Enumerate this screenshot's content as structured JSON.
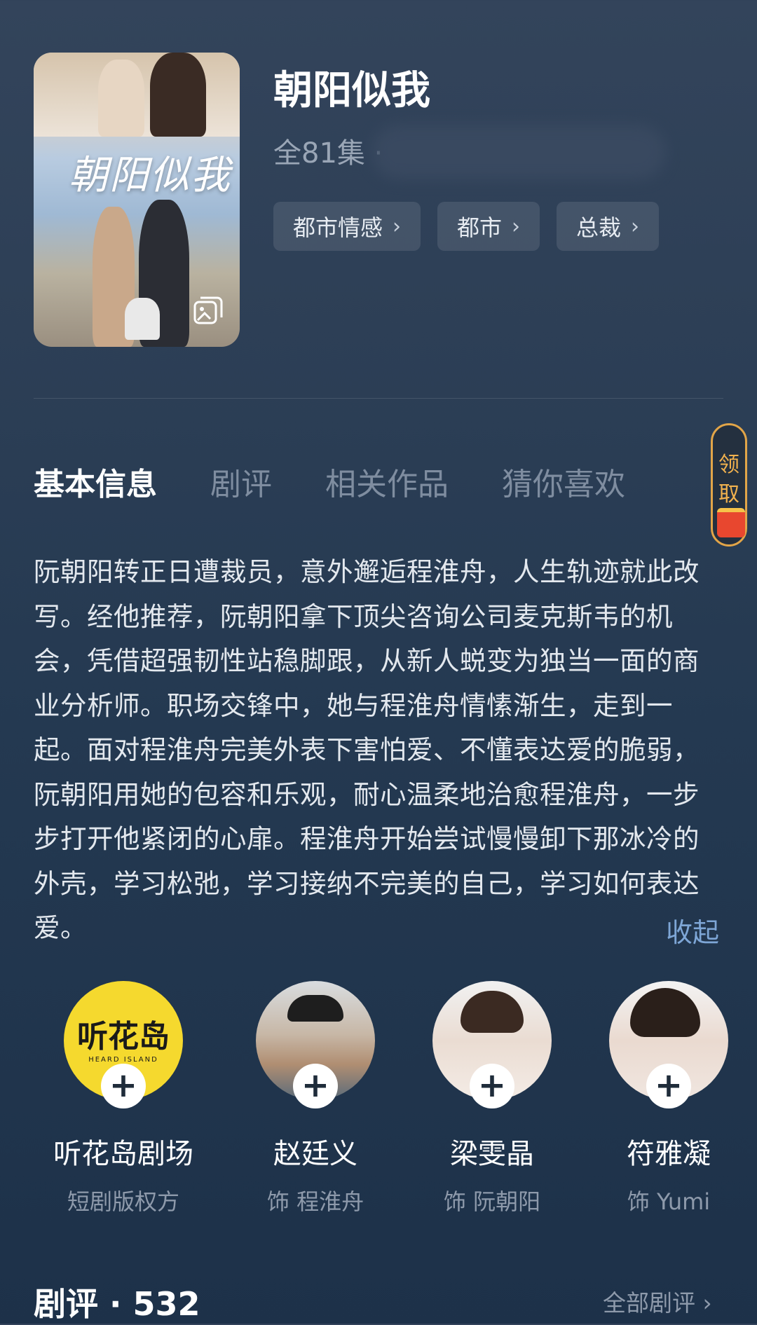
{
  "drama": {
    "title": "朝阳似我",
    "episodes": "全81集 ·",
    "poster_title": "朝阳似我"
  },
  "tags": [
    {
      "label": "都市情感",
      "chevron": "›"
    },
    {
      "label": "都市",
      "chevron": "›"
    },
    {
      "label": "总裁",
      "chevron": "›"
    }
  ],
  "tabs": [
    {
      "label": "基本信息",
      "active": true
    },
    {
      "label": "剧评",
      "active": false
    },
    {
      "label": "相关作品",
      "active": false
    },
    {
      "label": "猜你喜欢",
      "active": false
    }
  ],
  "reward": {
    "label_1": "领",
    "label_2": "取"
  },
  "synopsis": {
    "text": "阮朝阳转正日遭裁员，意外邂逅程淮舟，人生轨迹就此改写。经他推荐，阮朝阳拿下顶尖咨询公司麦克斯韦的机会，凭借超强韧性站稳脚跟，从新人蜕变为独当一面的商业分析师。职场交锋中，她与程淮舟情愫渐生，走到一起。面对程淮舟完美外表下害怕爱、不懂表达爱的脆弱，阮朝阳用她的包容和乐观，耐心温柔地治愈程淮舟，一步步打开他紧闭的心扉。程淮舟开始尝试慢慢卸下那冰冷的外壳，学习松弛，学习接纳不完美的自己，学习如何表达爱。",
    "collapse_label": "收起"
  },
  "cast": [
    {
      "name": "听花岛剧场",
      "role": "短剧版权方",
      "logo_text": "听花岛",
      "logo_sub": "HEARD ISLAND",
      "plus": "+"
    },
    {
      "name": "赵廷义",
      "role": "饰 程淮舟",
      "plus": "+"
    },
    {
      "name": "梁雯晶",
      "role": "饰 阮朝阳",
      "plus": "+"
    },
    {
      "name": "符雅凝",
      "role": "饰 Yumi",
      "plus": "+"
    }
  ],
  "reviews": {
    "title": "剧评 · 532",
    "all_label": "全部剧评 ›"
  },
  "colors": {
    "background_top": "#33445b",
    "background_bottom": "#1d3149",
    "accent_link": "#7ea6d6",
    "reward_gold": "#e2a548",
    "logo_yellow": "#f5d92e"
  }
}
